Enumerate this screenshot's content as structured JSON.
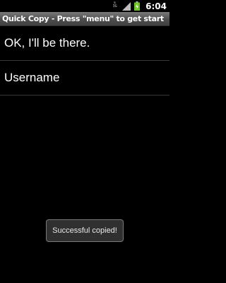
{
  "status_bar": {
    "network_type": "3G",
    "time": "6:04",
    "icons": [
      "network-activity-icon",
      "signal-strength-icon",
      "battery-charging-icon"
    ]
  },
  "app": {
    "title": "Quick Copy - Press \"menu\" to get start"
  },
  "list": {
    "items": [
      {
        "label": "OK, I'll be there."
      },
      {
        "label": "Username"
      }
    ]
  },
  "toast": {
    "message": "Successful copied!"
  },
  "colors": {
    "background": "#000000",
    "title_bar": "#4e4e4e",
    "divider": "#3a3a3a",
    "battery_green": "#6cc428"
  }
}
